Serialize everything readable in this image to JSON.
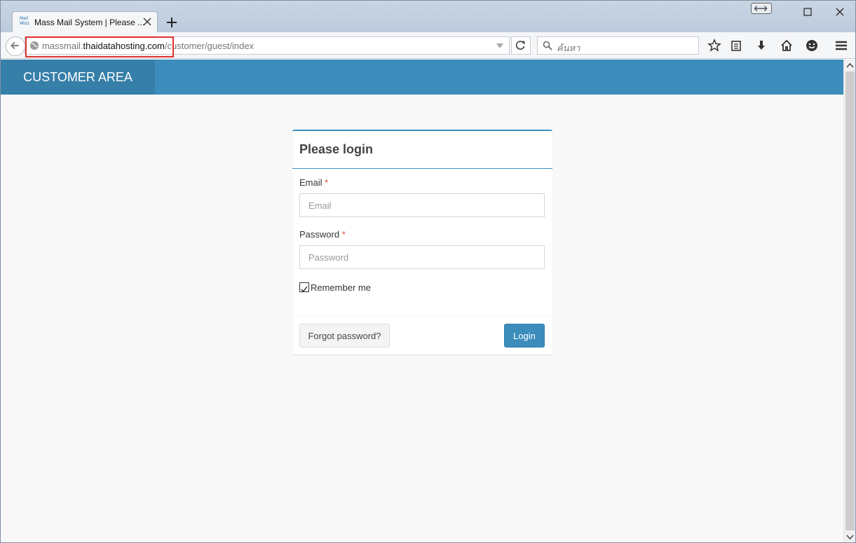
{
  "browser": {
    "tab_title": "Mass Mail System | Please ...",
    "favicon_text_line1": "Mail",
    "favicon_text_line2": "Wizz",
    "url_prefix": "massmail.",
    "url_domain": "thaidatahosting.com",
    "url_path": "/customer/guest/index",
    "search_placeholder": "ค้นหา",
    "highlight_color": "#e0322f"
  },
  "header": {
    "brand": "CUSTOMER AREA",
    "color": "#3c8dbc"
  },
  "login": {
    "title": "Please login",
    "email_label": "Email",
    "email_placeholder": "Email",
    "password_label": "Password",
    "password_placeholder": "Password",
    "required_mark": "*",
    "remember_label": "Remember me",
    "remember_checked": true,
    "forgot_label": "Forgot password?",
    "login_label": "Login"
  },
  "icons": {
    "back": "back-arrow-icon",
    "reload": "reload-icon",
    "search": "search-icon",
    "bookmark": "star-icon",
    "reading_list": "reading-list-icon",
    "downloads": "download-icon",
    "home": "home-icon",
    "hello": "smiley-icon",
    "menu": "hamburger-menu-icon"
  }
}
